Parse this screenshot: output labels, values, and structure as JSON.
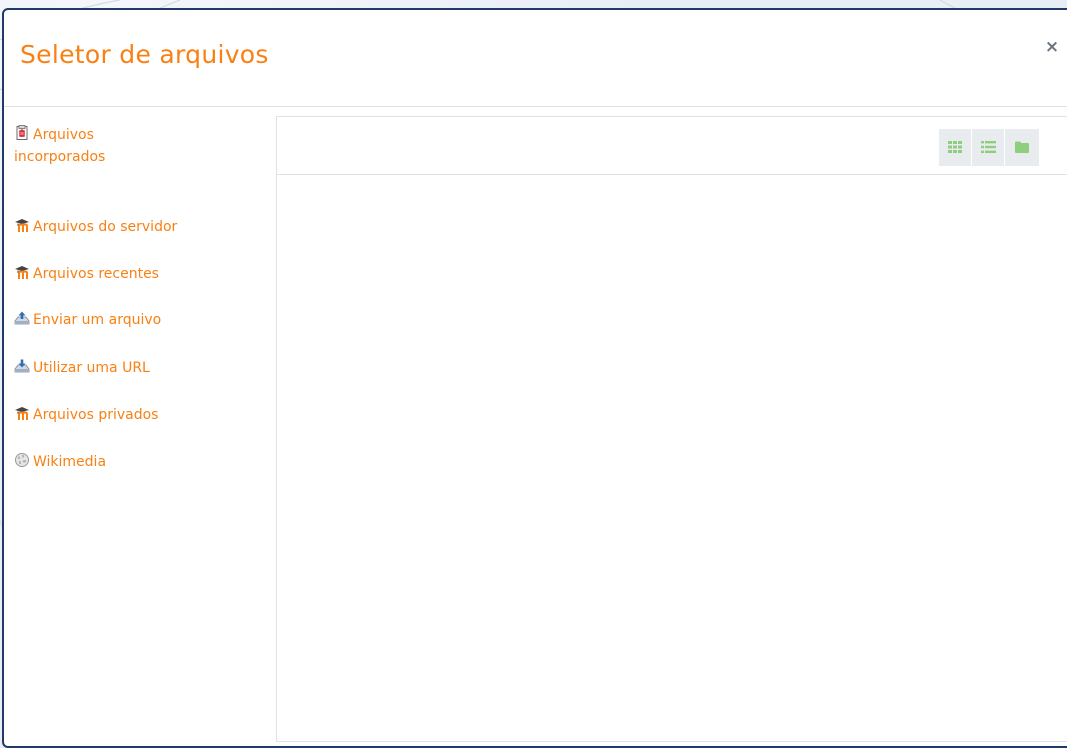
{
  "dialog": {
    "title": "Seletor de arquivos",
    "close_label": "×"
  },
  "sidebar": {
    "items": [
      {
        "label": "Arquivos incorporados",
        "line1": "Arquivos",
        "line2": "incorporados",
        "icon": "embedded-files-icon"
      },
      {
        "label": "Arquivos do servidor",
        "icon": "moodle-icon"
      },
      {
        "label": "Arquivos recentes",
        "icon": "moodle-icon"
      },
      {
        "label": "Enviar um arquivo",
        "icon": "upload-icon"
      },
      {
        "label": "Utilizar uma URL",
        "icon": "url-download-icon"
      },
      {
        "label": "Arquivos privados",
        "icon": "moodle-icon"
      },
      {
        "label": "Wikimedia",
        "icon": "wikimedia-globe-icon"
      }
    ]
  },
  "toolbar": {
    "view_buttons": [
      {
        "icon": "grid-view-icon"
      },
      {
        "icon": "list-view-icon"
      },
      {
        "icon": "folder-view-icon"
      }
    ]
  },
  "colors": {
    "accent": "#f98012",
    "border": "#1f3a6b",
    "icon_green": "#8fce7f",
    "button_bg": "#e9ecef"
  }
}
